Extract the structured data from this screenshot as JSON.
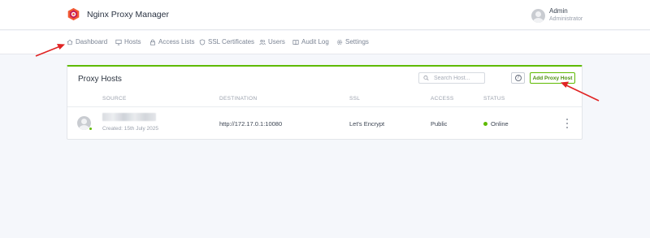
{
  "brand": {
    "name": "Nginx Proxy Manager"
  },
  "user": {
    "name": "Admin",
    "role": "Administrator"
  },
  "nav": {
    "items": [
      {
        "label": "Dashboard"
      },
      {
        "label": "Hosts"
      },
      {
        "label": "Access Lists"
      },
      {
        "label": "SSL Certificates"
      },
      {
        "label": "Users"
      },
      {
        "label": "Audit Log"
      },
      {
        "label": "Settings"
      }
    ]
  },
  "card": {
    "title": "Proxy Hosts",
    "search_placeholder": "Search Host...",
    "help_label": "?",
    "add_button_label": "Add Proxy Host",
    "columns": [
      "SOURCE",
      "DESTINATION",
      "SSL",
      "ACCESS",
      "STATUS"
    ],
    "rows": [
      {
        "created": "Created: 15th July 2025",
        "destination": "http://172.17.0.1:10080",
        "ssl": "Let's Encrypt",
        "access": "Public",
        "status": "Online"
      }
    ]
  },
  "colors": {
    "accent": "#5eba00",
    "annotation_arrow": "#e02424"
  }
}
